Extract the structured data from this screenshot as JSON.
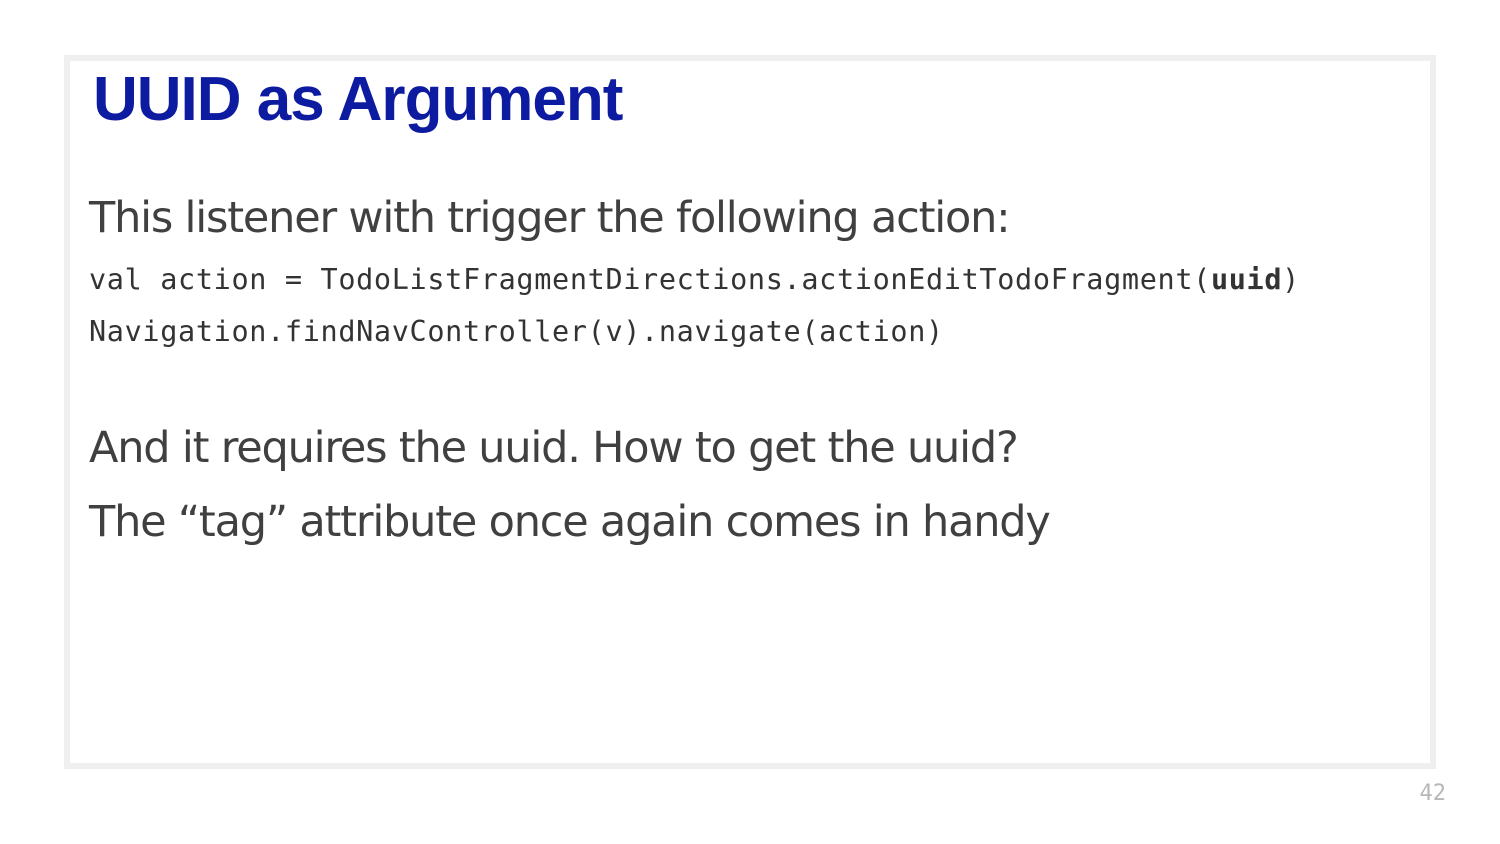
{
  "colors": {
    "title": "#0d1ba0",
    "body_text": "#404040",
    "code_text": "#333333",
    "page_number": "#b7b7b7",
    "frame_border": "#efefef"
  },
  "slide": {
    "title": "UUID as Argument",
    "intro_text": "This listener with trigger the following action:",
    "code": {
      "line1_prefix": "val action = TodoListFragmentDirections.actionEditTodoFragment(",
      "line1_arg": "uuid",
      "line1_suffix": ")",
      "line2": "Navigation.findNavController(v).navigate(action)"
    },
    "question_text": "And it requires the uuid. How to get the uuid?",
    "answer_text": "The “tag” attribute once again comes in handy",
    "page_number": "42"
  }
}
